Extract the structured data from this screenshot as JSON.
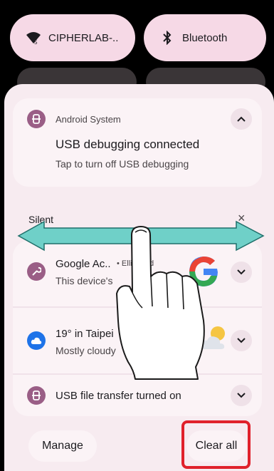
{
  "quick_tiles": {
    "wifi_label": "CIPHERLAB-..",
    "bluetooth_label": "Bluetooth"
  },
  "notification_top": {
    "app_name": "Android System",
    "title": "USB debugging connected",
    "body": "Tap to turn off USB debugging"
  },
  "silent_section": {
    "header": "Silent",
    "dismiss_glyph": "×"
  },
  "notifications": [
    {
      "app_icon": "wrench-icon",
      "title": "Google Ac..",
      "meta": "• Elli... 14d",
      "body": "This device's"
    },
    {
      "app_icon": "cloud-icon",
      "title": "19° in Taipei",
      "body": "Mostly cloudy"
    },
    {
      "app_icon": "android-system-icon",
      "title": "USB file transfer turned on"
    }
  ],
  "footer": {
    "manage_label": "Manage",
    "clear_all_label": "Clear all"
  },
  "colors": {
    "highlight": "#e0212b",
    "swipe_arrow": "#6fd0c8",
    "tile": "#f6d9e6",
    "app_badge": "#9a5e86"
  }
}
